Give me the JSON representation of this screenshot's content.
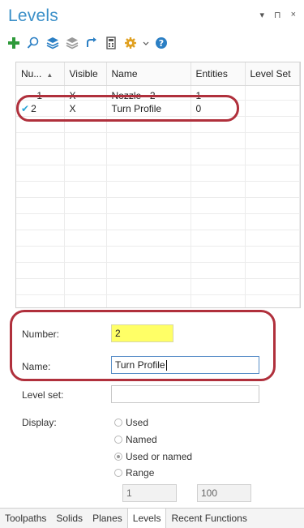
{
  "panel": {
    "title": "Levels",
    "pin_glyph": "▾",
    "pin2_glyph": "⊓",
    "close_glyph": "×"
  },
  "toolbar": {
    "icons": [
      "add-icon",
      "search-icon",
      "layers-icon",
      "layers-gray-icon",
      "undo-icon",
      "calculator-icon",
      "gear-icon",
      "help-icon"
    ]
  },
  "table": {
    "columns": [
      "Nu...",
      "Visible",
      "Name",
      "Entities",
      "Level Set"
    ],
    "rows": [
      {
        "number": "1",
        "visible": "X",
        "name": "Nozzle - 2",
        "entities": "1",
        "level_set": ""
      },
      {
        "number": "2",
        "visible": "X",
        "name": "Turn Profile",
        "entities": "0",
        "level_set": "",
        "check": "✔"
      }
    ]
  },
  "form": {
    "number_label": "Number:",
    "number_value": "2",
    "name_label": "Name:",
    "name_value": "Turn Profile",
    "level_set_label": "Level set:",
    "level_set_value": "",
    "display_label": "Display:",
    "display_options": [
      "Used",
      "Named",
      "Used or named",
      "Range"
    ],
    "display_selected": "Used or named",
    "range_from": "1",
    "range_to": "100"
  },
  "tabs": [
    "Toolpaths",
    "Solids",
    "Planes",
    "Levels",
    "Recent Functions"
  ],
  "active_tab": "Levels",
  "colors": {
    "accent": "#3a8fc8",
    "highlight_ring": "#b0303c",
    "number_field": "#ffff66"
  }
}
